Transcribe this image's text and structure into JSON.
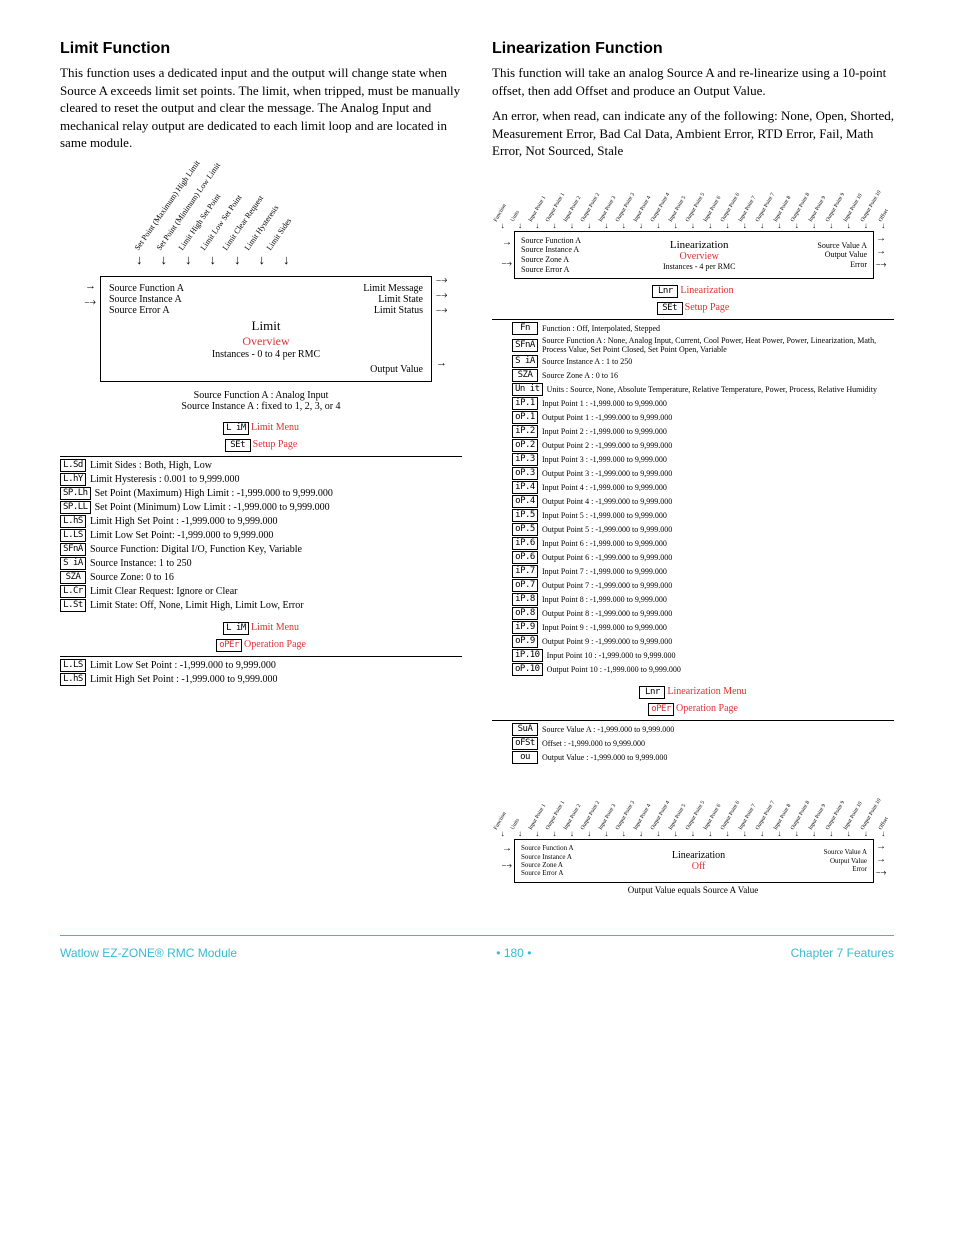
{
  "left": {
    "heading": "Limit Function",
    "para": "This function uses a dedicated input and the output will change state when Source A exceeds limit set points. The limit, when tripped, must be manually cleared to reset the output and clear the message. The Analog Input and mechanical relay output are dedicated to each limit loop and are located in same module.",
    "angled": [
      "Set Point (Maximum) High Limit",
      "Set Point (Minimum) Low Limit",
      "Limit High Set Point",
      "Limit Low Set Point",
      "Limit Clear Request",
      "Limit Hysteresis",
      "Limit Sides"
    ],
    "box": {
      "l1": "Source Function A",
      "l2": "Source Instance A",
      "l3": "Source Error A",
      "r1": "Limit Message",
      "r2": "Limit State",
      "r3": "Limit Status",
      "title": "Limit",
      "overview": "Overview",
      "inst": "Instances - 0 to 4 per RMC",
      "out": "Output Value"
    },
    "note1": "Source Function A : Analog Input",
    "note2": "Source Instance A : fixed to 1, 2, 3, or 4",
    "menu1_code": "L iM",
    "menu1_name": "Limit Menu",
    "menu1_page_code": "SEt",
    "menu1_page": "Setup Page",
    "params": [
      {
        "c": "L.Sd",
        "t": "Limit Sides : Both, High, Low"
      },
      {
        "c": "L.hY",
        "t": "Limit Hysteresis : 0.001 to 9,999.000"
      },
      {
        "c": "SP.Lh",
        "t": "Set Point (Maximum) High Limit : -1,999.000 to 9,999.000"
      },
      {
        "c": "SP.LL",
        "t": "Set Point (Minimum) Low Limit : -1,999.000 to 9,999.000"
      },
      {
        "c": "L.hS",
        "t": "Limit High Set Point : -1,999.000 to 9,999.000"
      },
      {
        "c": "L.LS",
        "t": "Limit Low Set Point: -1,999.000 to 9,999.000"
      },
      {
        "c": "SFnA",
        "t": "Source Function: Digital I/O, Function Key, Variable"
      },
      {
        "c": "S iA",
        "t": "Source Instance: 1 to 250"
      },
      {
        "c": "SZA",
        "t": "Source Zone: 0 to 16"
      },
      {
        "c": "L.Cr",
        "t": "Limit Clear Request: Ignore or Clear"
      },
      {
        "c": "L.St",
        "t": "Limit State: Off, None, Limit High, Limit Low, Error"
      }
    ],
    "menu2_code": "L iM",
    "menu2_name": "Limit Menu",
    "menu2_page_code": "oPEr",
    "menu2_page": "Operation Page",
    "params2": [
      {
        "c": "L.LS",
        "t": "Limit Low Set Point : -1,999.000 to 9,999.000"
      },
      {
        "c": "L.hS",
        "t": "Limit High Set Point : -1,999.000 to 9,999.000"
      }
    ]
  },
  "right": {
    "heading": "Linearization Function",
    "para1": "This function will take an analog Source A and re-linearize using a 10-point offset, then add Offset and produce an Output Value.",
    "para2": "An error, when read, can indicate any of the following: None, Open, Shorted, Measurement Error, Bad Cal Data, Ambient Error, RTD Error, Fail, Math Error, Not Sourced, Stale",
    "angled_top": [
      "Function",
      "Units",
      "Input Point 1",
      "Output Point 1",
      "Input Point 2",
      "Output Point 2",
      "Input Point 3",
      "Output Point 3",
      "Input Point 4",
      "Output Point 4",
      "Input Point 5",
      "Output Point 5",
      "Input Point 6",
      "Output Point 6",
      "Input Point 7",
      "Output Point 7",
      "Input Point 8",
      "Output Point 8",
      "Input Point 9",
      "Output Point 9",
      "Input Point 10",
      "Output Point 10",
      "Offset"
    ],
    "srcbox1": {
      "l": [
        "Source Function A",
        "Source Instance A",
        "Source Zone A",
        "Source Error A"
      ],
      "title": "Linearization",
      "ov": "Overview",
      "inst": "Instances - 4 per RMC",
      "r": [
        "Source Value A",
        "Output Value",
        "Error"
      ]
    },
    "menu1_code": "Lnr",
    "menu1_name": "Linearization",
    "menu1_page_code": "SEt",
    "menu1_page": "Setup Page",
    "params": [
      {
        "c": "Fn",
        "t": "Function : Off, Interpolated, Stepped"
      },
      {
        "c": "SFnA",
        "t": "Source Function A : None, Analog Input, Current, Cool Power, Heat Power, Power, Linearization, Math, Process Value, Set Point Closed, Set Point Open, Variable"
      },
      {
        "c": "S iA",
        "t": "Source Instance A : 1 to 250"
      },
      {
        "c": "SZA",
        "t": "Source Zone A : 0 to 16"
      },
      {
        "c": "Un it",
        "t": "Units : Source, None, Absolute Temperature, Relative Temperature, Power, Process, Relative Humidity"
      },
      {
        "c": "iP.1",
        "t": "Input Point 1 : -1,999.000 to 9,999.000"
      },
      {
        "c": "oP.1",
        "t": "Output Point 1 : -1,999.000 to 9,999.000"
      },
      {
        "c": "iP.2",
        "t": "Input Point 2 : -1,999.000 to 9,999.000"
      },
      {
        "c": "oP.2",
        "t": "Output Point 2 : -1,999.000 to 9,999.000"
      },
      {
        "c": "iP.3",
        "t": "Input Point 3 : -1,999.000 to 9,999.000"
      },
      {
        "c": "oP.3",
        "t": "Output Point 3 : -1,999.000 to 9,999.000"
      },
      {
        "c": "iP.4",
        "t": "Input Point 4 : -1,999.000 to 9,999.000"
      },
      {
        "c": "oP.4",
        "t": "Output Point 4 : -1,999.000 to 9,999.000"
      },
      {
        "c": "iP.5",
        "t": "Input Point 5 : -1,999.000 to 9,999.000"
      },
      {
        "c": "oP.5",
        "t": "Output Point 5 : -1,999.000 to 9,999.000"
      },
      {
        "c": "iP.6",
        "t": "Input Point 6 : -1,999.000 to 9,999.000"
      },
      {
        "c": "oP.6",
        "t": "Output Point 6 : -1,999.000 to 9,999.000"
      },
      {
        "c": "iP.7",
        "t": "Input Point 7 : -1,999.000 to 9,999.000"
      },
      {
        "c": "oP.7",
        "t": "Output Point 7 : -1,999.000 to 9,999.000"
      },
      {
        "c": "iP.8",
        "t": "Input Point 8 : -1,999.000 to 9,999.000"
      },
      {
        "c": "oP.8",
        "t": "Output Point 8 : -1,999.000 to 9,999.000"
      },
      {
        "c": "iP.9",
        "t": "Input Point 9 : -1,999.000 to 9,999.000"
      },
      {
        "c": "oP.9",
        "t": "Output Point 9 : -1,999.000 to 9,999.000"
      },
      {
        "c": "iP.10",
        "t": "Input Point 10 : -1,999.000 to 9,999.000"
      },
      {
        "c": "oP.10",
        "t": "Output Point 10 : -1,999.000 to 9,999.000"
      }
    ],
    "menu2_code": "Lnr",
    "menu2_name": "Linearization Menu",
    "menu2_page_code": "oPEr",
    "menu2_page": "Operation Page",
    "params2": [
      {
        "c": "SuA",
        "t": "Source Value A : -1,999.000 to 9,999.000"
      },
      {
        "c": "oFSt",
        "t": "Offset : -1,999.000 to 9,999.000"
      },
      {
        "c": "ou",
        "t": "Output Value : -1,999.000 to 9,999.000"
      }
    ],
    "srcbox2": {
      "l": [
        "Source Function A",
        "Source Instance A",
        "Source Zone A",
        "Source Error A"
      ],
      "title": "Linearization",
      "ov": "Off",
      "r": [
        "Source Value A",
        "Output Value",
        "Error"
      ]
    },
    "caption": "Output Value equals Source A Value"
  },
  "footer": {
    "left": "Watlow EZ-ZONE® RMC Module",
    "mid": "•  180  •",
    "right": "Chapter 7 Features"
  }
}
